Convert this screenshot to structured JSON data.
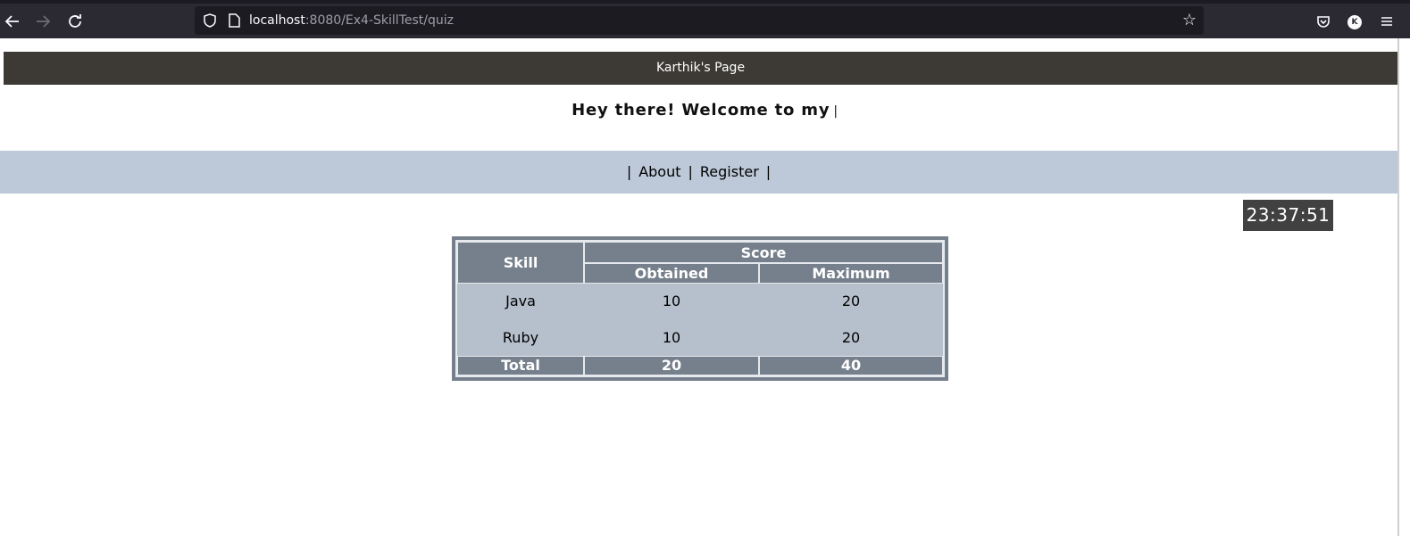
{
  "browser": {
    "url_host": "localhost",
    "url_rest": ":8080/Ex4-SkillTest/quiz",
    "profile_initial": "K",
    "icons": [
      "back-arrow-icon",
      "forward-arrow-icon",
      "reload-icon",
      "shield-icon",
      "page-icon",
      "star-icon",
      "pocket-icon",
      "account-icon",
      "menu-icon"
    ]
  },
  "page": {
    "header_title": "Karthik's Page",
    "welcome_text": "Hey there! Welcome to my",
    "welcome_cursor": "|",
    "nav": {
      "sep": "|",
      "about_label": "About",
      "register_label": "Register"
    },
    "clock": "23:37:51"
  },
  "score_table": {
    "headers": {
      "skill": "Skill",
      "score": "Score",
      "obtained": "Obtained",
      "maximum": "Maximum"
    },
    "rows": [
      {
        "skill": "Java",
        "obtained": "10",
        "maximum": "20"
      },
      {
        "skill": "Ruby",
        "obtained": "10",
        "maximum": "20"
      }
    ],
    "total": {
      "label": "Total",
      "obtained": "20",
      "maximum": "40"
    }
  },
  "colors": {
    "header_bar": "#3d3a35",
    "nav_bar": "#bdc9d8",
    "table_header": "#76808c",
    "table_cell": "#b6bfcc",
    "clock_bg": "#414141"
  }
}
